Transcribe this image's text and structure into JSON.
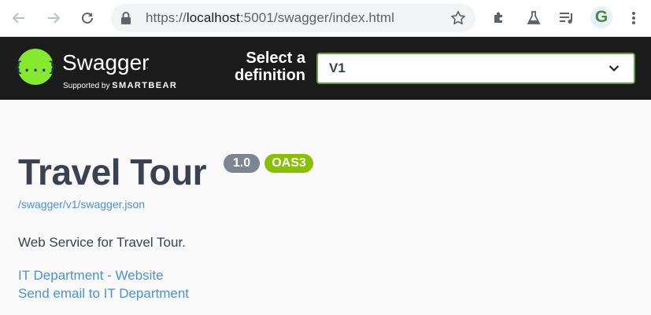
{
  "browser": {
    "url_prefix": "https://",
    "url_host": "localhost",
    "url_rest": ":5001/swagger/index.html",
    "profile_initial": "G",
    "icons": [
      "back-arrow-icon",
      "forward-arrow-icon",
      "reload-icon",
      "lock-icon",
      "star-icon",
      "puzzle-extension-icon",
      "flask-icon",
      "playlist-music-icon",
      "kebab-menu-icon"
    ]
  },
  "topbar": {
    "brand": "Swagger",
    "trademark": ".",
    "supported_by": "Supported by",
    "sponsor": "SMARTBEAR",
    "logo_glyph": "{...}",
    "select_label_line1": "Select a",
    "select_label_line2": "definition",
    "selected_definition": "V1",
    "colors": {
      "bar": "#1b1b1b",
      "logo": "#85ea2d",
      "select_border": "#62a03f"
    }
  },
  "info": {
    "title": "Travel Tour",
    "version_badge": "1.0",
    "spec_badge": "OAS3",
    "json_link": "/swagger/v1/swagger.json",
    "description": "Web Service for Travel Tour.",
    "links": [
      {
        "label": "IT Department - Website"
      },
      {
        "label": "Send email to IT Department"
      }
    ],
    "colors": {
      "title": "#3b4151",
      "version": "#7d8492",
      "oas": "#89bf04",
      "link": "#4990e2"
    }
  }
}
